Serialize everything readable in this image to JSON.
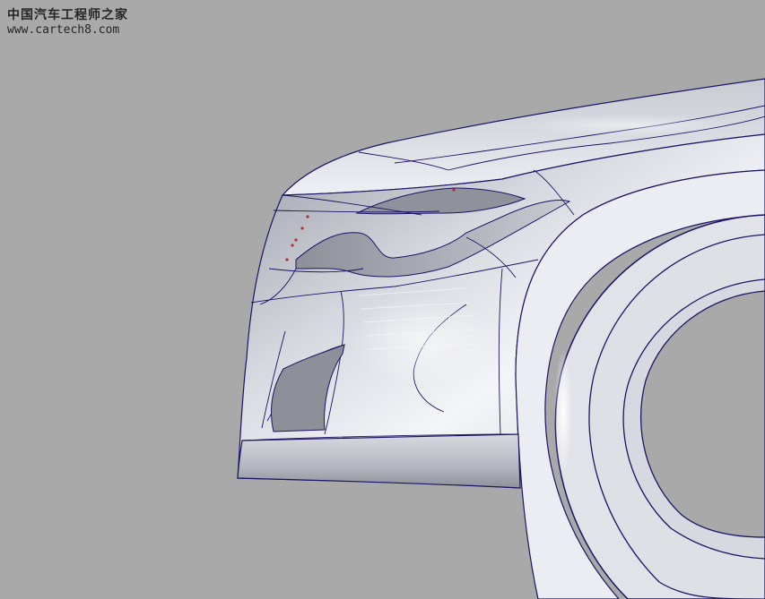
{
  "watermark": {
    "title": "中国汽车工程师之家",
    "url": "www.cartech8.com"
  },
  "colors": {
    "background": "#a9a9a9",
    "surface": "#e4e4ea",
    "edge_lines": "#1c1466",
    "watermark_text": "#262626"
  }
}
